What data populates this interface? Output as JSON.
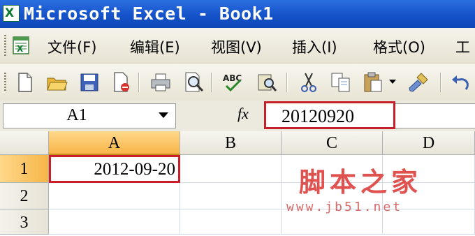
{
  "window": {
    "title": "Microsoft Excel - Book1"
  },
  "menu": {
    "items": [
      {
        "label": "文件(F)"
      },
      {
        "label": "编辑(E)"
      },
      {
        "label": "视图(V)"
      },
      {
        "label": "插入(I)"
      },
      {
        "label": "格式(O)"
      },
      {
        "label": "工"
      }
    ]
  },
  "toolbar": {
    "buttons": [
      "new-document-icon",
      "open-folder-icon",
      "save-icon",
      "permission-icon",
      "print-icon",
      "print-preview-icon",
      "spelling-icon",
      "research-icon",
      "cut-icon",
      "copy-icon",
      "paste-icon",
      "paste-dropdown-icon",
      "format-painter-icon",
      "undo-icon"
    ]
  },
  "formula_bar": {
    "name_box": "A1",
    "fx_label": "fx",
    "formula": "20120920"
  },
  "sheet": {
    "columns": [
      "A",
      "B",
      "C",
      "D"
    ],
    "rows": [
      "1",
      "2",
      "3"
    ],
    "cells": {
      "A1": "2012-09-20"
    }
  },
  "watermark": {
    "text": "脚本之家",
    "url": "www.jb51.net"
  },
  "colors": {
    "highlight_border": "#c8202a",
    "title_bar": "#1552c9",
    "watermark": "#e0524f"
  }
}
